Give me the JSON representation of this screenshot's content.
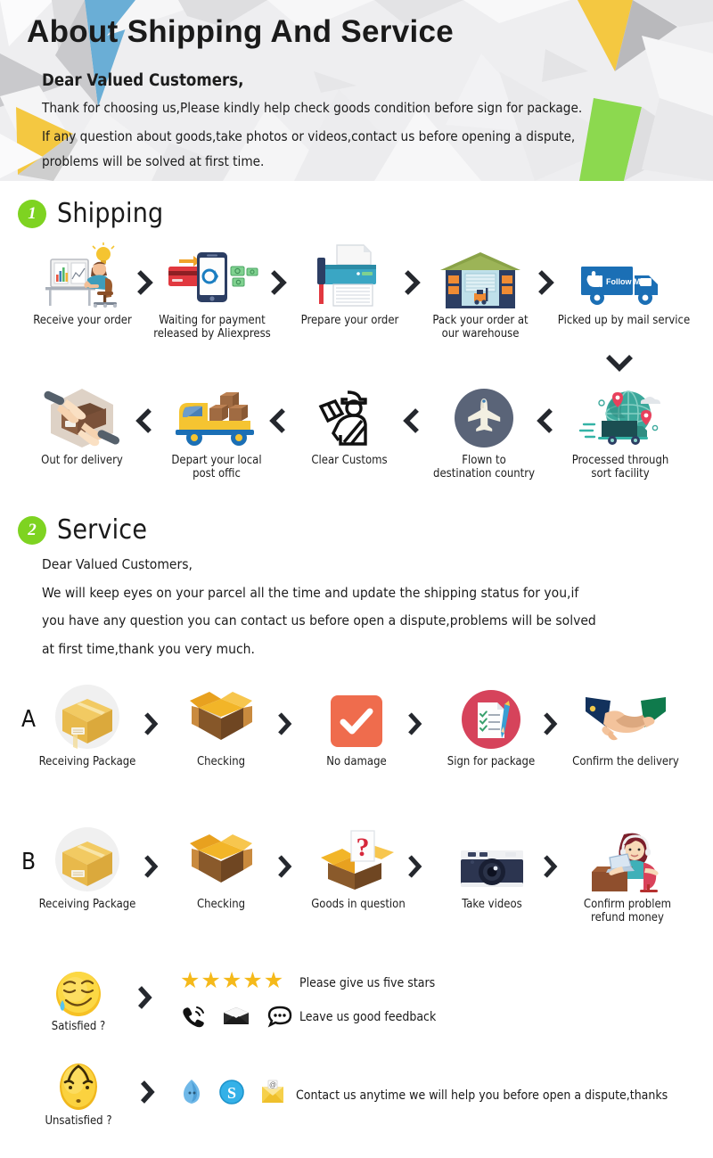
{
  "header": {
    "title": "About Shipping And Service",
    "salutation": "Dear Valued Customers,",
    "line1": "Thank for choosing us,Please kindly help check goods condition before sign for package.",
    "line2": "If any question about goods,take photos or videos,contact us before opening a dispute,",
    "line3": "problems will be solved at first time."
  },
  "sections": {
    "shipping": {
      "badge": "1",
      "title": "Shipping"
    },
    "service": {
      "badge": "2",
      "title": "Service"
    }
  },
  "service_intro": {
    "salutation": "Dear Valued Customers,",
    "line1": "We will keep eyes on your parcel all the time and update the shipping status for you,if",
    "line2": "you have any question you can contact us before open a dispute,problems will be solved",
    "line3": "at first time,thank you very much."
  },
  "shipping_flow": {
    "row1_direction": "left-to-right",
    "row1": [
      {
        "icon": "desk-computer-order-icon",
        "label": "Receive your order"
      },
      {
        "icon": "mobile-payment-icon",
        "label": "Waiting for payment\nreleased by Aliexpress"
      },
      {
        "icon": "printer-icon",
        "label": "Prepare your order"
      },
      {
        "icon": "warehouse-icon",
        "label": "Pack your order at\nour warehouse"
      },
      {
        "icon": "follow-me-truck-icon",
        "label": "Picked up by mail service"
      }
    ],
    "row2_direction": "right-to-left",
    "row2": [
      {
        "icon": "hands-package-delivery-icon",
        "label": "Out for delivery"
      },
      {
        "icon": "yellow-delivery-van-icon",
        "label": "Depart your local\npost offic"
      },
      {
        "icon": "customs-officer-icon",
        "label": "Clear Customs"
      },
      {
        "icon": "airplane-circle-icon",
        "label": "Flown to\ndestination country"
      },
      {
        "icon": "globe-sort-facility-icon",
        "label": "Processed through\nsort facility"
      }
    ],
    "row_connector_icon": "chevron-down-icon",
    "step_arrow_icon": "chevron-right-icon",
    "step_arrow_back_icon": "chevron-left-icon"
  },
  "service_flow": {
    "rowA_label": "A",
    "rowA": [
      {
        "icon": "closed-parcel-box-icon",
        "label": "Receiving Package"
      },
      {
        "icon": "open-box-icon",
        "label": "Checking"
      },
      {
        "icon": "red-check-badge-icon",
        "label": "No damage"
      },
      {
        "icon": "signed-checklist-icon",
        "label": "Sign for package"
      },
      {
        "icon": "handshake-icon",
        "label": "Confirm the delivery"
      }
    ],
    "rowB_label": "B",
    "rowB": [
      {
        "icon": "closed-parcel-box-icon",
        "label": "Receiving Package"
      },
      {
        "icon": "open-box-icon",
        "label": "Checking"
      },
      {
        "icon": "question-box-icon",
        "label": "Goods in question"
      },
      {
        "icon": "camera-icon",
        "label": "Take videos"
      },
      {
        "icon": "support-agent-icon",
        "label": "Confirm problem\nrefund money"
      }
    ]
  },
  "feedback": {
    "satisfied": {
      "icon": "relieved-smiley-icon",
      "label": "Satisfied ?",
      "stars_count": 5,
      "star_icon": "star-icon",
      "stars_text": "Please give us five stars",
      "contact_icons": [
        "phone-ringing-icon",
        "envelope-icon",
        "chat-bubble-icon"
      ],
      "feedback_text": "Leave us good feedback"
    },
    "unsatisfied": {
      "icon": "worried-smiley-icon",
      "label": "Unsatisfied ?",
      "contact_icons": [
        "messenger-drop-icon",
        "skype-icon",
        "email-at-icon"
      ],
      "text": "Contact us anytime we will help you before open a dispute,thanks"
    }
  },
  "colors": {
    "badge_green": "#7ed321",
    "accent_blue": "#1b6fb5",
    "accent_red": "#d6435b",
    "accent_orange": "#ef6c4d",
    "star_gold": "#f5b91a",
    "chevron_dark": "#25282e",
    "header_bg": "#ececed"
  }
}
